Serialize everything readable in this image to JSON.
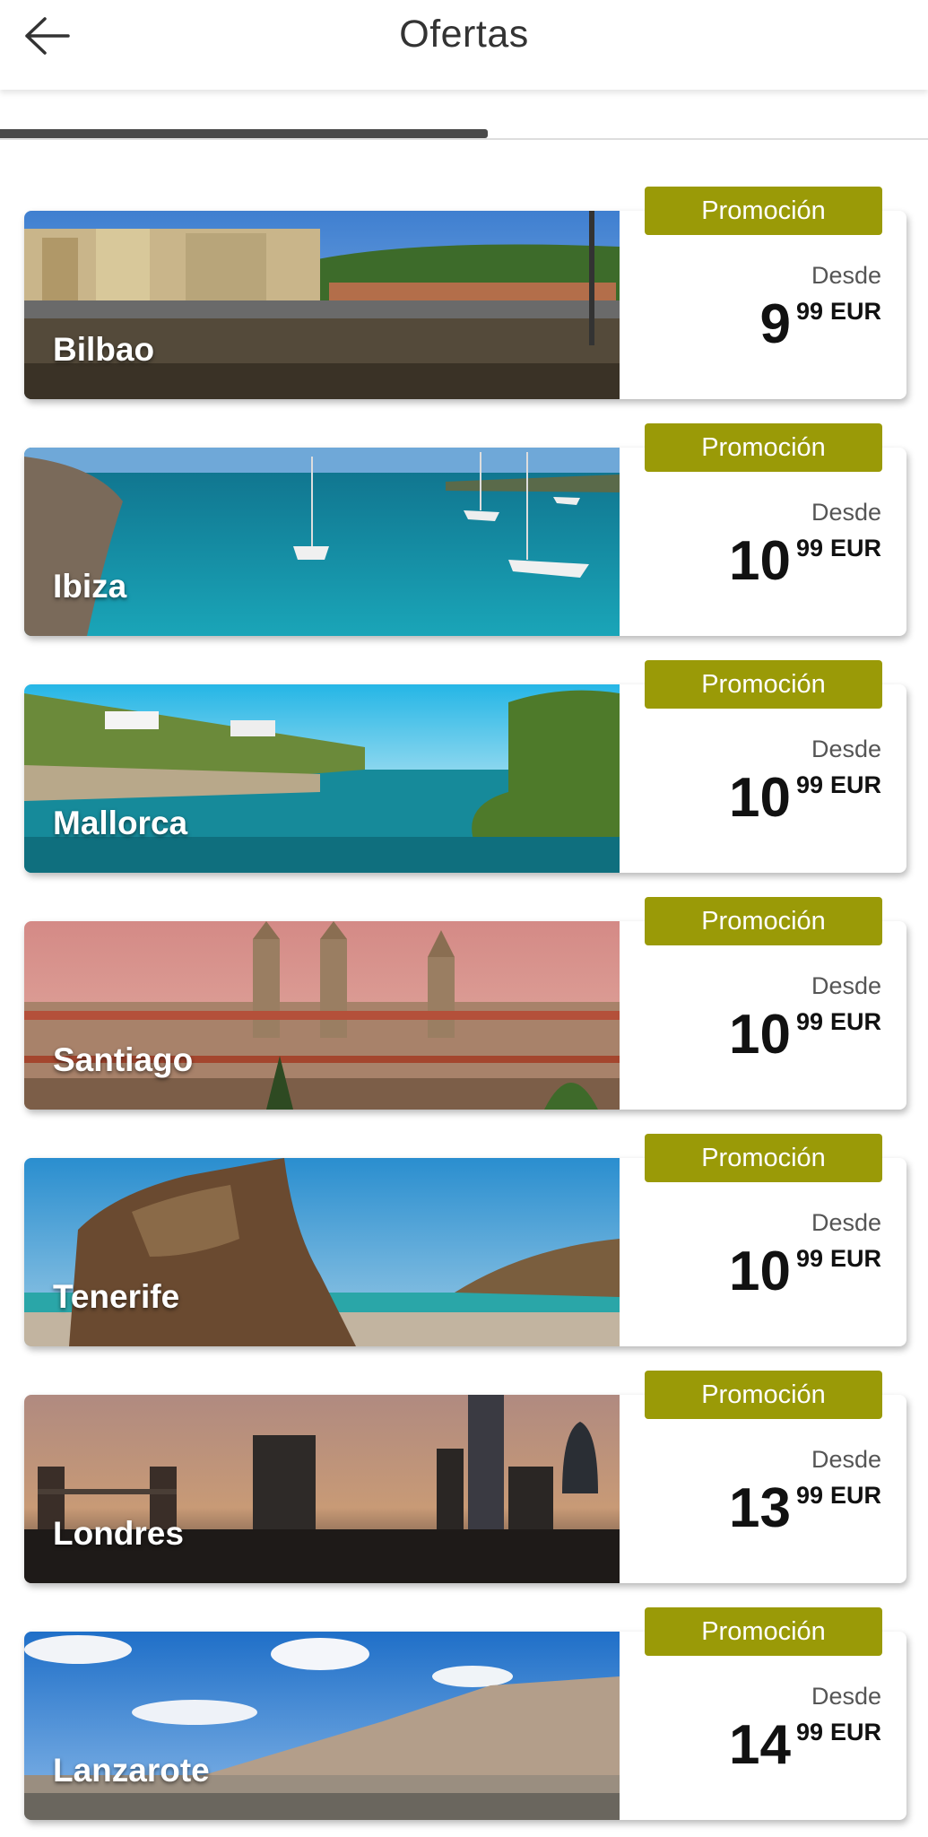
{
  "header": {
    "title": "Ofertas",
    "back_icon": "arrow-left-icon"
  },
  "colors": {
    "badge": "#9a9a07",
    "indicator": "#4a4a4a"
  },
  "offers": [
    {
      "city": "Bilbao",
      "badge": "Promoción",
      "from": "Desde",
      "price_int": "9",
      "price_dec": "99",
      "currency": "EUR"
    },
    {
      "city": "Ibiza",
      "badge": "Promoción",
      "from": "Desde",
      "price_int": "10",
      "price_dec": "99",
      "currency": "EUR"
    },
    {
      "city": "Mallorca",
      "badge": "Promoción",
      "from": "Desde",
      "price_int": "10",
      "price_dec": "99",
      "currency": "EUR"
    },
    {
      "city": "Santiago",
      "badge": "Promoción",
      "from": "Desde",
      "price_int": "10",
      "price_dec": "99",
      "currency": "EUR"
    },
    {
      "city": "Tenerife",
      "badge": "Promoción",
      "from": "Desde",
      "price_int": "10",
      "price_dec": "99",
      "currency": "EUR"
    },
    {
      "city": "Londres",
      "badge": "Promoción",
      "from": "Desde",
      "price_int": "13",
      "price_dec": "99",
      "currency": "EUR"
    },
    {
      "city": "Lanzarote",
      "badge": "Promoción",
      "from": "Desde",
      "price_int": "14",
      "price_dec": "99",
      "currency": "EUR"
    }
  ]
}
